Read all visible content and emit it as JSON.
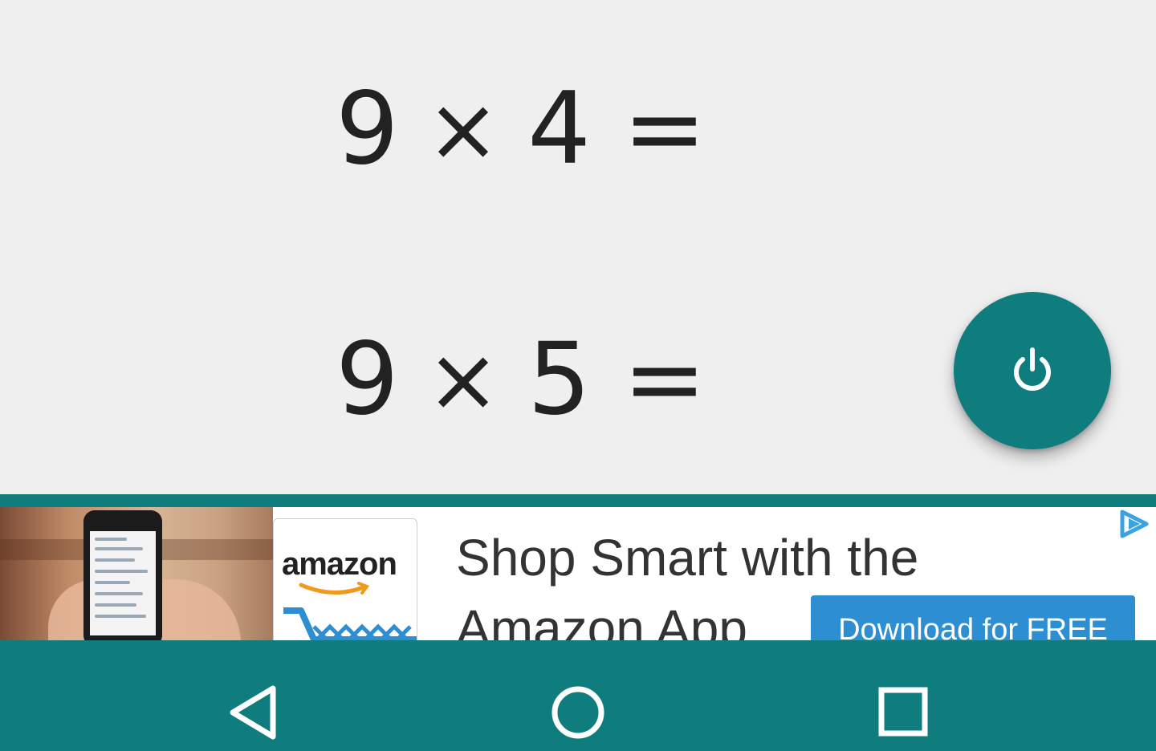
{
  "problems": [
    {
      "a": "9",
      "op": "×",
      "b": "4",
      "eq": "="
    },
    {
      "a": "9",
      "op": "×",
      "b": "5",
      "eq": "="
    }
  ],
  "fab": {
    "icon": "power-icon",
    "color": "#0f7d7d"
  },
  "ad": {
    "logo_text": "amazon",
    "headline": "Shop Smart with the",
    "subline": "Amazon App",
    "cta_label": "Download for FREE",
    "cta_color": "#2d8fd1",
    "adchoices_icon": "adchoices-icon"
  },
  "navbar": {
    "color": "#0f7d7d",
    "buttons": [
      {
        "icon": "back-icon"
      },
      {
        "icon": "home-icon"
      },
      {
        "icon": "recents-icon"
      }
    ]
  }
}
